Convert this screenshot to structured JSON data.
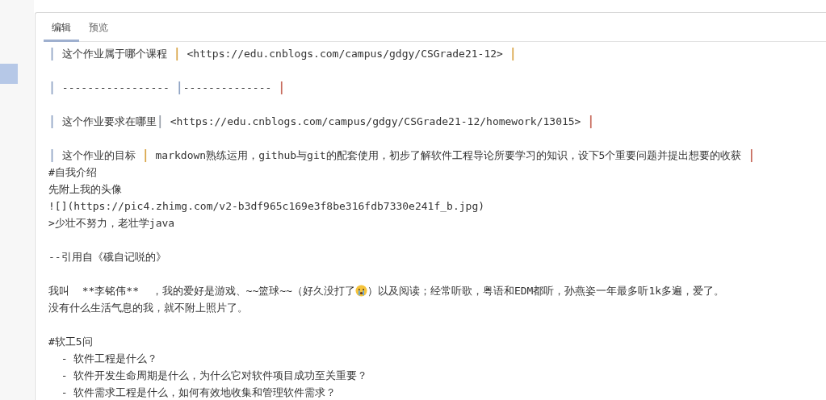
{
  "tabs": [
    {
      "label": "编辑",
      "selected": true
    },
    {
      "label": "预览",
      "selected": false
    }
  ],
  "sidebar": {
    "items": [
      {
        "selected": true
      }
    ]
  },
  "editor": {
    "lines": [
      {
        "kind": "text",
        "segments": [
          {
            "kind": "pipe",
            "text": "|",
            "color": "#8fa3c4"
          },
          {
            "kind": "text",
            "text": " 这个作业属于哪个课程 "
          },
          {
            "kind": "pipe",
            "text": "|",
            "color": "#d9a548"
          },
          {
            "kind": "text",
            "text": " <https://edu.cnblogs.com/campus/gdgy/CSGrade21-12> "
          },
          {
            "kind": "pipe",
            "text": "|",
            "color": "#d9a548"
          }
        ]
      },
      {
        "kind": "blank"
      },
      {
        "kind": "text",
        "segments": [
          {
            "kind": "pipe",
            "text": "|",
            "color": "#8fa3c4"
          },
          {
            "kind": "text",
            "text": " ----------------- "
          },
          {
            "kind": "pipe",
            "text": "|",
            "color": "#8fa3c4"
          },
          {
            "kind": "text",
            "text": "-------------- "
          },
          {
            "kind": "pipe",
            "text": "|",
            "color": "#c76a5c"
          }
        ]
      },
      {
        "kind": "blank"
      },
      {
        "kind": "text",
        "segments": [
          {
            "kind": "pipe",
            "text": "|",
            "color": "#8fa3c4"
          },
          {
            "kind": "text",
            "text": " 这个作业要求在哪里"
          },
          {
            "kind": "pipe",
            "text": "|",
            "color": "#9aa0aa"
          },
          {
            "kind": "text",
            "text": " <https://edu.cnblogs.com/campus/gdgy/CSGrade21-12/homework/13015> "
          },
          {
            "kind": "pipe",
            "text": "|",
            "color": "#c76a5c"
          }
        ]
      },
      {
        "kind": "blank"
      },
      {
        "kind": "text",
        "segments": [
          {
            "kind": "pipe",
            "text": "|",
            "color": "#8fa3c4"
          },
          {
            "kind": "text",
            "text": " 这个作业的目标 "
          },
          {
            "kind": "pipe",
            "text": "|",
            "color": "#d9a548"
          },
          {
            "kind": "text",
            "text": " markdown熟练运用，github与git的配套使用，初步了解软件工程导论所要学习的知识，设下5个重要问题并提出想要的收获 "
          },
          {
            "kind": "pipe",
            "text": "|",
            "color": "#c76a5c"
          }
        ]
      },
      {
        "kind": "text",
        "segments": [
          {
            "kind": "text",
            "text": "#自我介绍"
          }
        ]
      },
      {
        "kind": "text",
        "segments": [
          {
            "kind": "text",
            "text": "先附上我的头像"
          }
        ]
      },
      {
        "kind": "text",
        "segments": [
          {
            "kind": "text",
            "text": "![](https://pic4.zhimg.com/v2-b3df965c169e3f8be316fdb7330e241f_b.jpg)"
          }
        ]
      },
      {
        "kind": "text",
        "segments": [
          {
            "kind": "text",
            "text": ">少壮不努力，老壮学java"
          }
        ]
      },
      {
        "kind": "blank"
      },
      {
        "kind": "text",
        "segments": [
          {
            "kind": "text",
            "text": "--引用自《硪自记哾的》"
          }
        ]
      },
      {
        "kind": "blank"
      },
      {
        "kind": "text",
        "segments": [
          {
            "kind": "text",
            "text": "我叫  **李铭伟**  ，我的爱好是游戏、~~篮球~~（好久没打了"
          },
          {
            "kind": "emoji"
          },
          {
            "kind": "text",
            "text": "）以及阅读；经常听歌，粤语和EDM都听，孙燕姿一年最多听1k多遍，爱了。"
          }
        ]
      },
      {
        "kind": "text",
        "segments": [
          {
            "kind": "text",
            "text": "没有什么生活气息的我，就不附上照片了。"
          }
        ]
      },
      {
        "kind": "blank"
      },
      {
        "kind": "text",
        "segments": [
          {
            "kind": "text",
            "text": "#软工5问"
          }
        ]
      },
      {
        "kind": "text",
        "segments": [
          {
            "kind": "text",
            "text": "  - 软件工程是什么？"
          }
        ]
      },
      {
        "kind": "text",
        "segments": [
          {
            "kind": "text",
            "text": "  - 软件开发生命周期是什么，为什么它对软件项目成功至关重要？"
          }
        ]
      },
      {
        "kind": "text",
        "segments": [
          {
            "kind": "text",
            "text": "  - 软件需求工程是什么，如何有效地收集和管理软件需求？"
          }
        ]
      }
    ]
  }
}
